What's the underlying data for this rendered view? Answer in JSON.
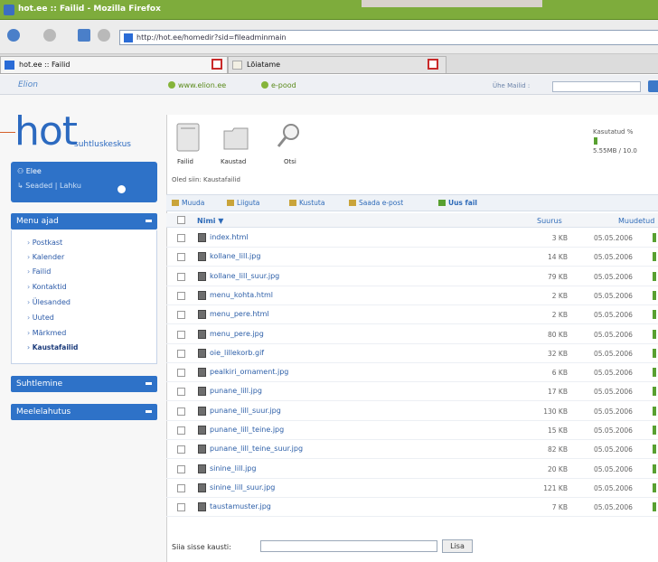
{
  "window": {
    "title": "hot.ee :: Failid - Mozilla Firefox"
  },
  "browser": {
    "url": "http://hot.ee/homedir?sid=fileadminmain",
    "tabs": [
      {
        "label": "hot.ee :: Failid"
      },
      {
        "label": "Lõiatame"
      }
    ]
  },
  "topbar": {
    "logo": "Elion",
    "link1": "www.elion.ee",
    "link2": "e-pood",
    "online_label": "Ühe Mailid :"
  },
  "brand": {
    "name": "hot",
    "subtitle": "suhtluskeskus"
  },
  "user": {
    "name": "Elee",
    "links": "Seaded | Lahku"
  },
  "sidebar": {
    "menu_title": "Menu ajad",
    "menu_items": [
      "Postkast",
      "Kalender",
      "Failid",
      "Kontaktid",
      "Ülesanded",
      "Uuted",
      "Märkmed",
      "Kaustafailid"
    ],
    "active_index": 7,
    "panel2_title": "Suhtlemine",
    "panel3_title": "Meelelahutus"
  },
  "toolbar": {
    "items": [
      "Failid",
      "Kaustad",
      "Otsi"
    ]
  },
  "quota": {
    "label": "Kasutatud %",
    "value_text": "5.55MB / 10.0",
    "fraction": 0.05
  },
  "path": "Oled siin: Kaustafailid",
  "actions": [
    "Muuda",
    "Liiguta",
    "Kustuta",
    "Saada e-post",
    "Uus fail"
  ],
  "table": {
    "headers": {
      "name": "Nimi ▼",
      "size": "Suurus",
      "date": "Muudetud"
    },
    "rows": [
      {
        "name": "index.html",
        "size": "3 KB",
        "date": "05.05.2006"
      },
      {
        "name": "kollane_lill.jpg",
        "size": "14 KB",
        "date": "05.05.2006"
      },
      {
        "name": "kollane_lill_suur.jpg",
        "size": "79 KB",
        "date": "05.05.2006"
      },
      {
        "name": "menu_kohta.html",
        "size": "2 KB",
        "date": "05.05.2006"
      },
      {
        "name": "menu_pere.html",
        "size": "2 KB",
        "date": "05.05.2006"
      },
      {
        "name": "menu_pere.jpg",
        "size": "80 KB",
        "date": "05.05.2006"
      },
      {
        "name": "oie_lillekorb.gif",
        "size": "32 KB",
        "date": "05.05.2006"
      },
      {
        "name": "pealkiri_ornament.jpg",
        "size": "6 KB",
        "date": "05.05.2006"
      },
      {
        "name": "punane_lill.jpg",
        "size": "17 KB",
        "date": "05.05.2006"
      },
      {
        "name": "punane_lill_suur.jpg",
        "size": "130 KB",
        "date": "05.05.2006"
      },
      {
        "name": "punane_lill_teine.jpg",
        "size": "15 KB",
        "date": "05.05.2006"
      },
      {
        "name": "punane_lill_teine_suur.jpg",
        "size": "82 KB",
        "date": "05.05.2006"
      },
      {
        "name": "sinine_lill.jpg",
        "size": "20 KB",
        "date": "05.05.2006"
      },
      {
        "name": "sinine_lill_suur.jpg",
        "size": "121 KB",
        "date": "05.05.2006"
      },
      {
        "name": "taustamuster.jpg",
        "size": "7 KB",
        "date": "05.05.2006"
      }
    ]
  },
  "search": {
    "label": "Siia sisse kausti:",
    "button": "Lisa"
  }
}
